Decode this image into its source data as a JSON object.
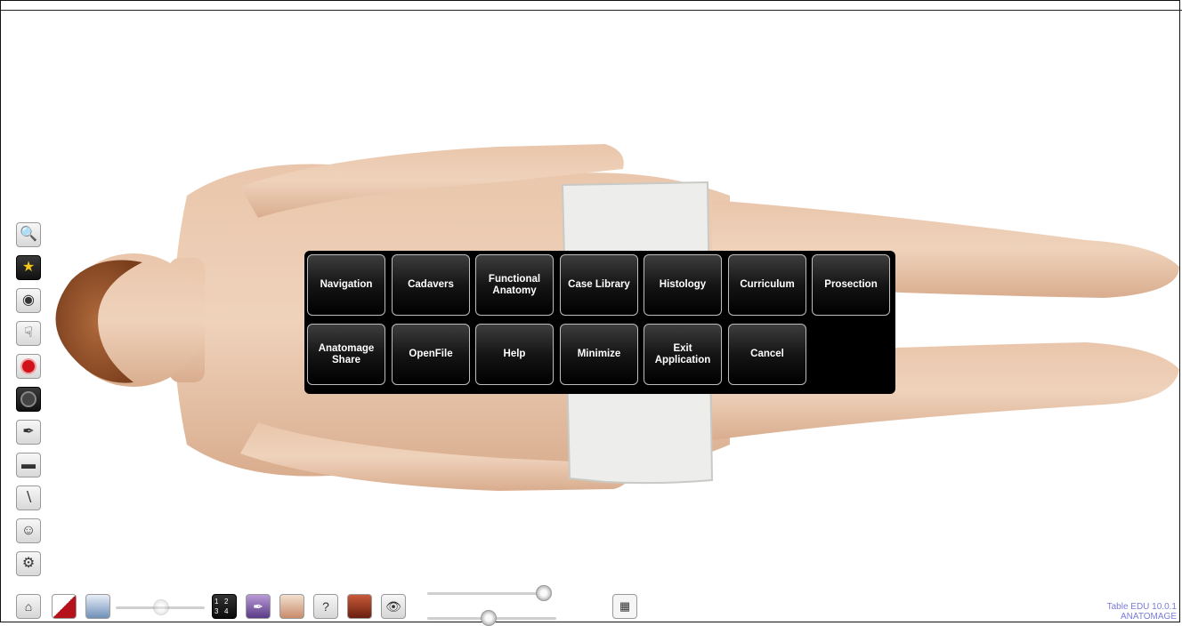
{
  "menu": {
    "row1": [
      "Navigation",
      "Cadavers",
      "Functional\nAnatomy",
      "Case Library",
      "Histology",
      "Curriculum",
      "Prosection"
    ],
    "row2": [
      "Anatomage\nShare",
      "OpenFile",
      "Help",
      "Minimize",
      "Exit\nApplication",
      "Cancel"
    ]
  },
  "version": {
    "line1": "Table EDU 10.0.1",
    "line2": "ANATOMAGE"
  },
  "left_toolbar_icons": [
    "magnifier-icon",
    "star-icon",
    "face-view-icon",
    "hand-pointer-icon",
    "record-icon",
    "camera-lens-icon",
    "scalpel-icon",
    "ruler-icon",
    "needle-icon",
    "compare-faces-icon",
    "settings-gear-icon"
  ],
  "bottom_toolbar_icons": [
    "home-icon",
    "cut-plane-icon",
    "layers-icon",
    "quad-view-icon",
    "annotation-icon",
    "organ-icon",
    "help-figure-icon",
    "tissue-icon",
    "eye-icon",
    "grid-menu-icon"
  ],
  "quad_view_labels": [
    "1",
    "2",
    "3",
    "4"
  ],
  "colors": {
    "menu_bg": "#000000",
    "version_text": "#7a7cd8",
    "skin": "#e6bfa3",
    "towel": "#ececea"
  }
}
